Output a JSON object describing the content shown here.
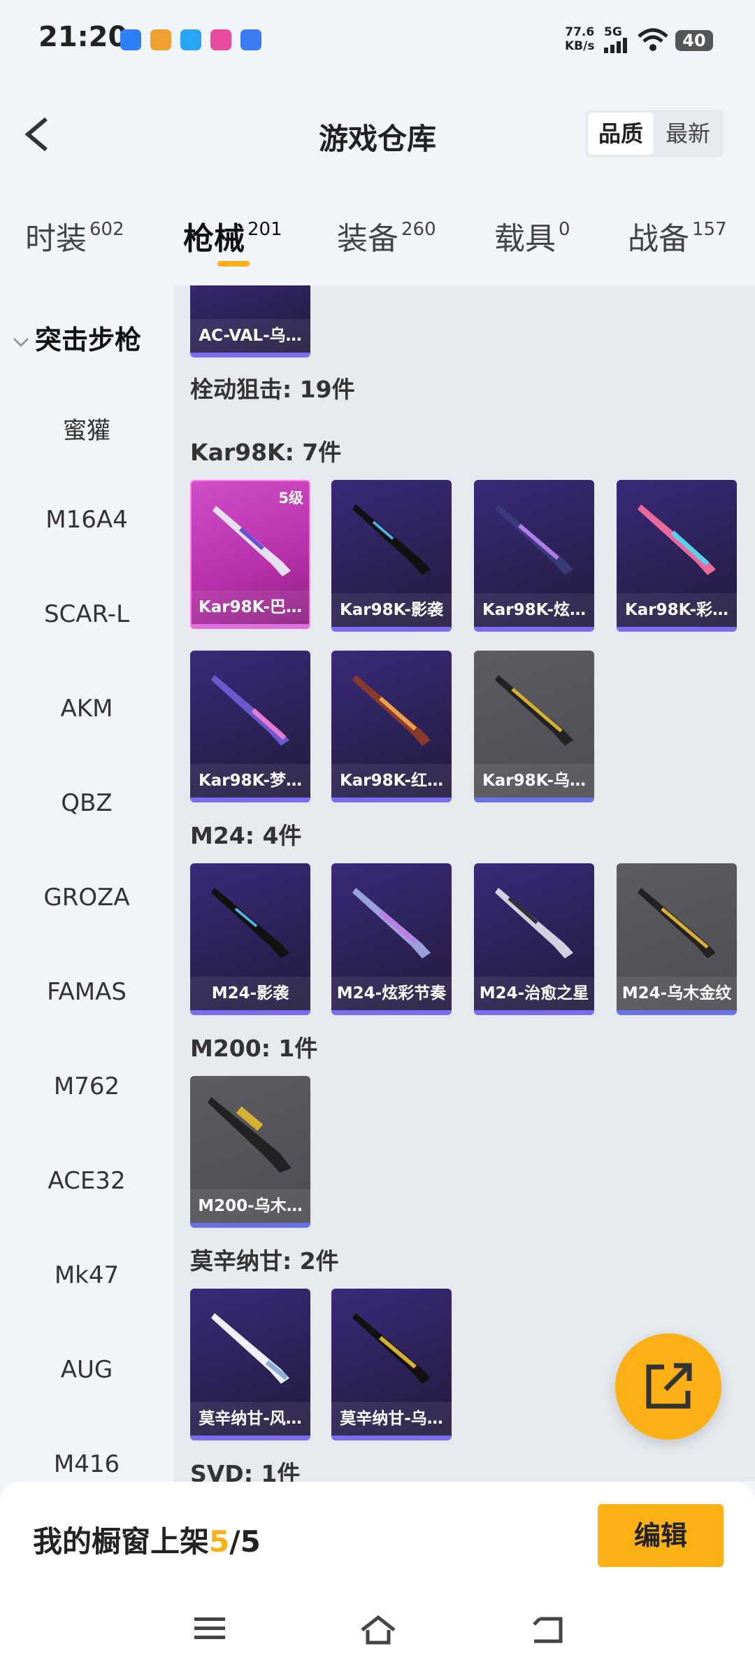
{
  "status_bar": {
    "time": "21:20",
    "net_speed_value": "77.6",
    "net_speed_unit": "KB/s",
    "network": "5G",
    "battery": "40",
    "app_icons": [
      "baidu-icon",
      "news-icon",
      "message-icon",
      "crown-icon",
      "browser-icon"
    ]
  },
  "header": {
    "title": "游戏仓库",
    "sort_quality": "品质",
    "sort_newest": "最新"
  },
  "tabs": [
    {
      "label": "时装",
      "count": "602"
    },
    {
      "label": "枪械",
      "count": "201"
    },
    {
      "label": "装备",
      "count": "260"
    },
    {
      "label": "载具",
      "count": "0"
    },
    {
      "label": "战备",
      "count": "157"
    }
  ],
  "sidebar": {
    "header": "突击步枪",
    "items": [
      "蜜獾",
      "M16A4",
      "SCAR-L",
      "AKM",
      "QBZ",
      "GROZA",
      "FAMAS",
      "M762",
      "ACE32",
      "Mk47",
      "AUG",
      "M416"
    ]
  },
  "content": {
    "top_card_name": "AC-VAL-乌…",
    "category_bolt": "栓动狙击: 19件",
    "groups": [
      {
        "label": "Kar98K: 7件",
        "items": [
          {
            "name": "Kar98K-巴…",
            "level": "5级"
          },
          {
            "name": "Kar98K-影袭"
          },
          {
            "name": "Kar98K-炫…"
          },
          {
            "name": "Kar98K-彩…"
          },
          {
            "name": "Kar98K-梦…"
          },
          {
            "name": "Kar98K-红…"
          },
          {
            "name": "Kar98K-乌…"
          }
        ]
      },
      {
        "label": "M24: 4件",
        "items": [
          {
            "name": "M24-影袭"
          },
          {
            "name": "M24-炫彩节奏"
          },
          {
            "name": "M24-治愈之星"
          },
          {
            "name": "M24-乌木金纹"
          }
        ]
      },
      {
        "label": "M200: 1件",
        "items": [
          {
            "name": "M200-乌木…"
          }
        ]
      },
      {
        "label": "莫辛纳甘: 2件",
        "items": [
          {
            "name": "莫辛纳甘-风…"
          },
          {
            "name": "莫辛纳甘-乌…"
          }
        ]
      },
      {
        "label": "SVD: 1件",
        "items": []
      }
    ]
  },
  "bottom": {
    "showcase_prefix": "我的橱窗上架",
    "showcase_current": "5",
    "showcase_total": "/5",
    "edit_label": "编辑"
  },
  "colors": {
    "accent": "#fbb016",
    "purple_quality": "#7d6cf0",
    "pink_quality": "#d14ec9",
    "gray_quality": "#5c5c62"
  }
}
